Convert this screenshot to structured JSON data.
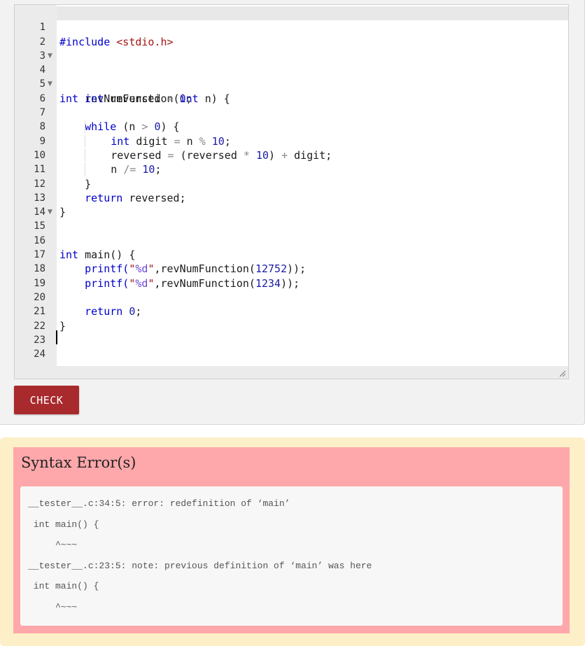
{
  "editor": {
    "line_numbers": [
      "1",
      "2",
      "3",
      "4",
      "5",
      "6",
      "7",
      "8",
      "9",
      "10",
      "11",
      "12",
      "13",
      "14",
      "15",
      "16",
      "17",
      "18",
      "19",
      "20",
      "21",
      "22",
      "23",
      "24"
    ],
    "fold_lines": [
      4,
      6,
      15
    ],
    "code": {
      "l1_directive": "#include",
      "l1_header": "<stdio.h>",
      "l4_type": "int",
      "l4_name": "revNumFunction(",
      "l4_ptype": "int",
      "l4_rest": "n) {",
      "l5_type": "int",
      "l5_var": "reversed",
      "l5_op": "=",
      "l5_num": "0",
      "l5_end": ";",
      "l6_kw": "while",
      "l6_a": "(n",
      "l6_op": ">",
      "l6_num": "0",
      "l6_end": ") {",
      "l8_type": "int",
      "l8_var": "digit",
      "l8_op1": "=",
      "l8_n": "n",
      "l8_op2": "%",
      "l8_num": "10",
      "l8_end": ";",
      "l9_var": "reversed",
      "l9_op1": "=",
      "l9_a": "(reversed",
      "l9_op2": "*",
      "l9_num": "10",
      "l9_b": ")",
      "l9_op3": "+",
      "l9_c": "digit;",
      "l10_var": "n",
      "l10_op": "/=",
      "l10_num": "10",
      "l10_end": ";",
      "l11": "}",
      "l12_kw": "return",
      "l12_rest": "reversed;",
      "l13": "}",
      "l15_type": "int",
      "l15_rest": "main() {",
      "l17_fn": "printf(",
      "l17_q1": "\"",
      "l17_fmt": "%d",
      "l17_q2": "\"",
      "l17_call": ",revNumFunction(",
      "l17_num": "12752",
      "l17_end": "));",
      "l18_fn": "printf(",
      "l18_q1": "\"",
      "l18_fmt": "%d",
      "l18_q2": "\"",
      "l18_call": ",revNumFunction(",
      "l18_num": "1234",
      "l18_end": "));",
      "l20_kw": "return",
      "l20_num": "0",
      "l20_end": ";",
      "l21": "}"
    }
  },
  "check_button": {
    "label": "CHECK"
  },
  "feedback": {
    "title": "Syntax Error(s)",
    "lines": [
      "__tester__.c:34:5: error: redefinition of ‘main’",
      " int main() {",
      "     ^~~~",
      "__tester__.c:23:5: note: previous definition of ‘main’ was here",
      " int main() {",
      "     ^~~~"
    ]
  },
  "colors": {
    "keyword": "#0000cc",
    "string": "#a31515",
    "button": "#a82a2d",
    "error_background": "#fea8ab",
    "feedback_background": "#fdf0c8"
  }
}
